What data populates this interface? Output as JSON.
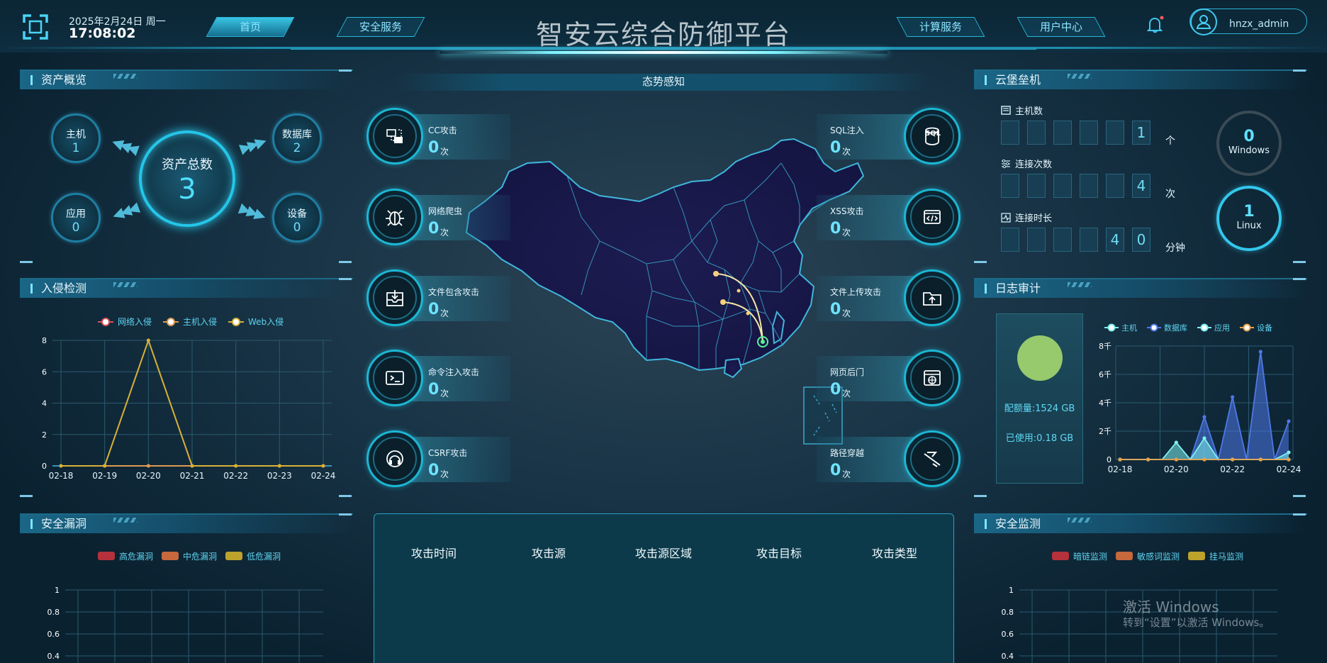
{
  "header": {
    "date": "2025年2月24日 周一",
    "time": "17:08:02",
    "title": "智安云综合防御平台",
    "nav": [
      {
        "label": "首页",
        "active": true
      },
      {
        "label": "安全服务",
        "active": false
      },
      {
        "label": "计算服务",
        "active": false
      },
      {
        "label": "用户中心",
        "active": false
      }
    ],
    "username": "hnzx_admin"
  },
  "asset_overview": {
    "title": "资产概览",
    "total_label": "资产总数",
    "total_value": "3",
    "items": [
      {
        "label": "主机",
        "value": "1"
      },
      {
        "label": "数据库",
        "value": "2"
      },
      {
        "label": "应用",
        "value": "0"
      },
      {
        "label": "设备",
        "value": "0"
      }
    ]
  },
  "situation": {
    "title": "态势感知"
  },
  "attacks_left": [
    {
      "name": "CC攻击",
      "value": "0",
      "unit": "次",
      "icon": "cc-attack-icon"
    },
    {
      "name": "网络爬虫",
      "value": "0",
      "unit": "次",
      "icon": "bug-icon"
    },
    {
      "name": "文件包含攻击",
      "value": "0",
      "unit": "次",
      "icon": "inbox-icon"
    },
    {
      "name": "命令注入攻击",
      "value": "0",
      "unit": "次",
      "icon": "terminal-icon"
    },
    {
      "name": "CSRF攻击",
      "value": "0",
      "unit": "次",
      "icon": "headset-icon"
    }
  ],
  "attacks_right": [
    {
      "name": "SQL注入",
      "value": "0",
      "unit": "次",
      "icon": "sql-database-icon",
      "icon_text": "SQL"
    },
    {
      "name": "XSS攻击",
      "value": "0",
      "unit": "次",
      "icon": "code-window-icon"
    },
    {
      "name": "文件上传攻击",
      "value": "0",
      "unit": "次",
      "icon": "folder-upload-icon"
    },
    {
      "name": "网页后门",
      "value": "0",
      "unit": "次",
      "icon": "web-backdoor-icon"
    },
    {
      "name": "路径穿越",
      "value": "0",
      "unit": "次",
      "icon": "path-traversal-icon"
    }
  ],
  "attack_table": {
    "headers": [
      "攻击时间",
      "攻击源",
      "攻击源区域",
      "攻击目标",
      "攻击类型"
    ],
    "rows": []
  },
  "cloud_fortress": {
    "title": "云堡垒机",
    "metrics": [
      {
        "label": "主机数",
        "digits": [
          "",
          "",
          "",
          "",
          "",
          "1"
        ],
        "unit": "个",
        "icon": "host-icon"
      },
      {
        "label": "连接次数",
        "digits": [
          "",
          "",
          "",
          "",
          "",
          "4"
        ],
        "unit": "次",
        "icon": "sliders-icon"
      },
      {
        "label": "连接时长",
        "digits": [
          "",
          "",
          "",
          "",
          "4",
          "0"
        ],
        "unit": "分钟",
        "icon": "pulse-icon"
      }
    ],
    "os": [
      {
        "value": "0",
        "label": "Windows"
      },
      {
        "value": "1",
        "label": "Linux"
      }
    ]
  },
  "log_audit": {
    "title": "日志审计",
    "quota_label": "配额量:1524 GB",
    "used_label": "已使用:0.18 GB",
    "used_fraction": 0.00012
  },
  "security_monitor": {
    "title": "安全监测"
  },
  "security_vuln": {
    "title": "安全漏洞"
  },
  "intrusion": {
    "title": "入侵检测"
  },
  "charts": {
    "intrusion": {
      "type": "line",
      "categories": [
        "02-18",
        "02-19",
        "02-20",
        "02-21",
        "02-22",
        "02-23",
        "02-24"
      ],
      "ylim": [
        0,
        8
      ],
      "yticks": [
        0,
        2,
        4,
        6,
        8
      ],
      "series": [
        {
          "name": "网络入侵",
          "color": "#d9505a",
          "values": [
            0,
            0,
            0,
            0,
            0,
            0,
            0
          ]
        },
        {
          "name": "主机入侵",
          "color": "#e09a50",
          "values": [
            0,
            0,
            0,
            0,
            0,
            0,
            0
          ]
        },
        {
          "name": "Web入侵",
          "color": "#d9b138",
          "values": [
            0,
            0,
            8,
            0,
            0,
            0,
            0
          ]
        }
      ]
    },
    "log": {
      "type": "area",
      "categories": [
        "02-18",
        "02-19",
        "02-20",
        "02-21",
        "02-22",
        "02-23",
        "02-24"
      ],
      "x": [
        0,
        1,
        2,
        3,
        4,
        5,
        6,
        7,
        8,
        9,
        10,
        11,
        12
      ],
      "x_tick_labels": [
        "02-18",
        "02-20",
        "02-22",
        "02-24"
      ],
      "ylim": [
        0,
        8000
      ],
      "yticks": [
        "0",
        "2千",
        "4千",
        "6千",
        "8千"
      ],
      "series": [
        {
          "name": "主机",
          "color": "#7ef0f0",
          "values": [
            0,
            0,
            0,
            0,
            0,
            0,
            0,
            0,
            0,
            0,
            0,
            0,
            0
          ]
        },
        {
          "name": "数据库",
          "color": "#4e78e8",
          "values": [
            0,
            0,
            0,
            0,
            0,
            0,
            3000,
            0,
            4400,
            0,
            7600,
            0,
            2700
          ]
        },
        {
          "name": "应用",
          "color": "#7ef0f0",
          "values": [
            0,
            0,
            0,
            0,
            1200,
            0,
            1500,
            0,
            0,
            0,
            0,
            0,
            500
          ]
        },
        {
          "name": "设备",
          "color": "#e9a045",
          "values": [
            0,
            0,
            0,
            0,
            0,
            0,
            0,
            0,
            0,
            0,
            0,
            0,
            0
          ]
        }
      ]
    },
    "vuln": {
      "type": "bar",
      "yticks": [
        "1",
        "0.8",
        "0.6",
        "0.4"
      ],
      "legend": [
        {
          "name": "高危漏洞",
          "color": "#b5313c"
        },
        {
          "name": "中危漏洞",
          "color": "#c7683d"
        },
        {
          "name": "低危漏洞",
          "color": "#bda22c"
        }
      ]
    },
    "monitor": {
      "type": "bar",
      "yticks": [
        "1",
        "0.8",
        "0.6",
        "0.4"
      ],
      "legend": [
        {
          "name": "暗链监测",
          "color": "#b5313c"
        },
        {
          "name": "敏感词监测",
          "color": "#c7683d"
        },
        {
          "name": "挂马监测",
          "color": "#bda22c"
        }
      ]
    }
  },
  "watermark": {
    "line1": "激活 Windows",
    "line2": "转到“设置”以激活 Windows。"
  }
}
